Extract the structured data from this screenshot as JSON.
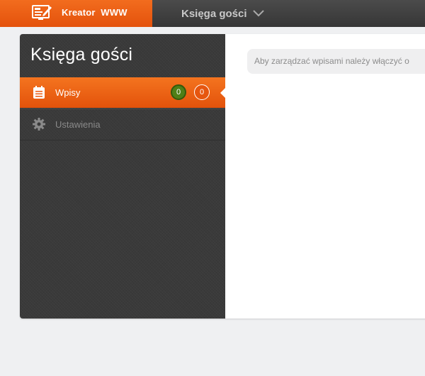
{
  "topbar": {
    "brand_title": "Kreator  WWW",
    "brand_icon": "site-builder-icon",
    "module_title": "Księga gości",
    "module_icon": "chevron-down-icon"
  },
  "sidebar": {
    "title": "Księga gości",
    "items": [
      {
        "label": "Wpisy",
        "icon": "calendar-icon",
        "active": true,
        "badges": [
          "0",
          "0"
        ]
      },
      {
        "label": "Ustawienia",
        "icon": "gear-icon",
        "active": false
      }
    ]
  },
  "content": {
    "notice": "Aby zarządzać wpisami należy włączyć o"
  },
  "colors": {
    "accent": "#f26c1e",
    "sidebar_bg": "#3a3a3a",
    "badge_green": "#4f7f17"
  }
}
